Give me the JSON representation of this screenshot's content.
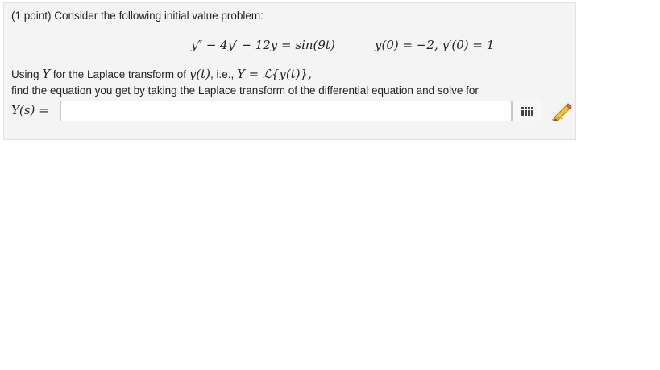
{
  "problem": {
    "intro": "(1 point) Consider the following initial value problem:",
    "equation": "y″ − 4y′ − 12y = sin(9t)",
    "initial_conditions": "y(0) = −2,  y′(0) = 1",
    "line1_text": "Using ",
    "line1_symbol": "Y",
    "line1_rest": " for the Laplace transform of ",
    "line1_func": "y(t)",
    "line1_ie": ", i.e., ",
    "line1_transform": "Y = ℒ{y(t)},",
    "line2": "find the equation you get by taking the Laplace transform of the differential equation and solve for",
    "answer_label": "Y(s) =",
    "answer_value": ""
  },
  "icons": {
    "palette": "equation-palette-icon",
    "pencil": "pencil-icon"
  },
  "colors": {
    "panel_bg": "#f4f4f4",
    "pencil_yellow": "#f2c12e",
    "pencil_tip": "#e86a4a"
  }
}
